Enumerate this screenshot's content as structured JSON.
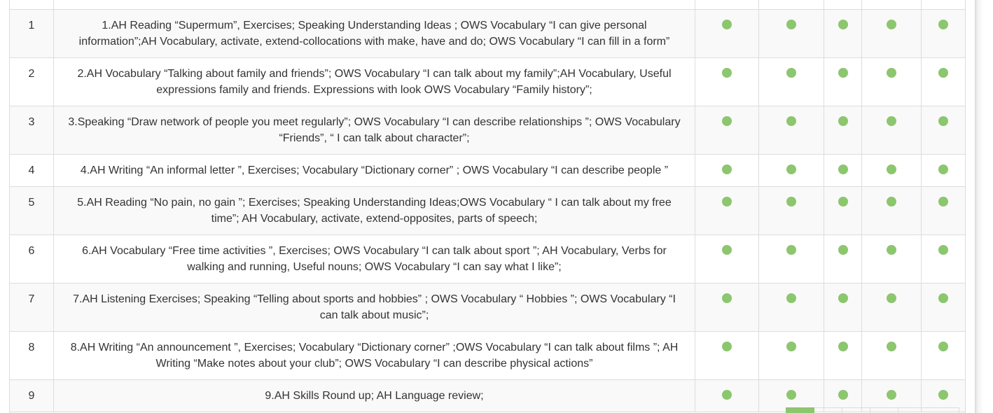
{
  "colors": {
    "status_dot": "#8cc66e",
    "border": "#dddddd",
    "stripe": "#f9f9f9"
  },
  "rows": [
    {
      "num": "1",
      "topic": "1.AH Reading “Supermum”, Exercises; Speaking Understanding Ideas ; OWS Vocabulary “I can give personal information”;AH Vocabulary, activate, extend-collocations with make, have and do; OWS Vocabulary “I can fill in a form”",
      "status": [
        "done",
        "done",
        "done",
        "done",
        "done"
      ]
    },
    {
      "num": "2",
      "topic": "2.AH Vocabulary “Talking about family and friends”; OWS Vocabulary “I can talk about my family”;AH Vocabulary, Useful expressions family and friends. Expressions with look OWS Vocabulary “Family history”;",
      "status": [
        "done",
        "done",
        "done",
        "done",
        "done"
      ]
    },
    {
      "num": "3",
      "topic": "3.Speaking “Draw network of people you meet regularly”; OWS Vocabulary “I can describe relationships ”; OWS Vocabulary “Friends”, “ I can talk about character”;",
      "status": [
        "done",
        "done",
        "done",
        "done",
        "done"
      ]
    },
    {
      "num": "4",
      "topic": "4.AH Writing “An informal letter ”, Exercises; Vocabulary “Dictionary corner” ; OWS Vocabulary “I can describe people ”",
      "status": [
        "done",
        "done",
        "done",
        "done",
        "done"
      ]
    },
    {
      "num": "5",
      "topic": "5.AH Reading “No pain, no gain ”; Exercises; Speaking Understanding Ideas;OWS Vocabulary “ I can talk about my free time”; AH Vocabulary, activate, extend-opposites, parts of speech;",
      "status": [
        "done",
        "done",
        "done",
        "done",
        "done"
      ]
    },
    {
      "num": "6",
      "topic": "6.AH Vocabulary “Free time activities ”, Exercises; OWS Vocabulary “I can talk about sport ”; AH Vocabulary, Verbs for walking and running, Useful nouns; OWS Vocabulary “I can say what I like”;",
      "status": [
        "done",
        "done",
        "done",
        "done",
        "done"
      ]
    },
    {
      "num": "7",
      "topic": "7.AH Listening Exercises; Speaking “Telling about sports and hobbies” ; OWS Vocabulary “ Hobbies ”; OWS Vocabulary “I can talk about music”;",
      "status": [
        "done",
        "done",
        "done",
        "done",
        "done"
      ]
    },
    {
      "num": "8",
      "topic": "8.AH Writing “An announcement ”, Exercises; Vocabulary “Dictionary corner” ;OWS Vocabulary “I can talk about films ”; AH Writing “Make notes about your club”; OWS Vocabulary “I can describe physical actions”",
      "status": [
        "done",
        "done",
        "done",
        "done",
        "done"
      ]
    },
    {
      "num": "9",
      "topic": "9.AH Skills Round up; AH Language review;",
      "status": [
        "done",
        "done",
        "done",
        "done",
        "done"
      ]
    }
  ]
}
